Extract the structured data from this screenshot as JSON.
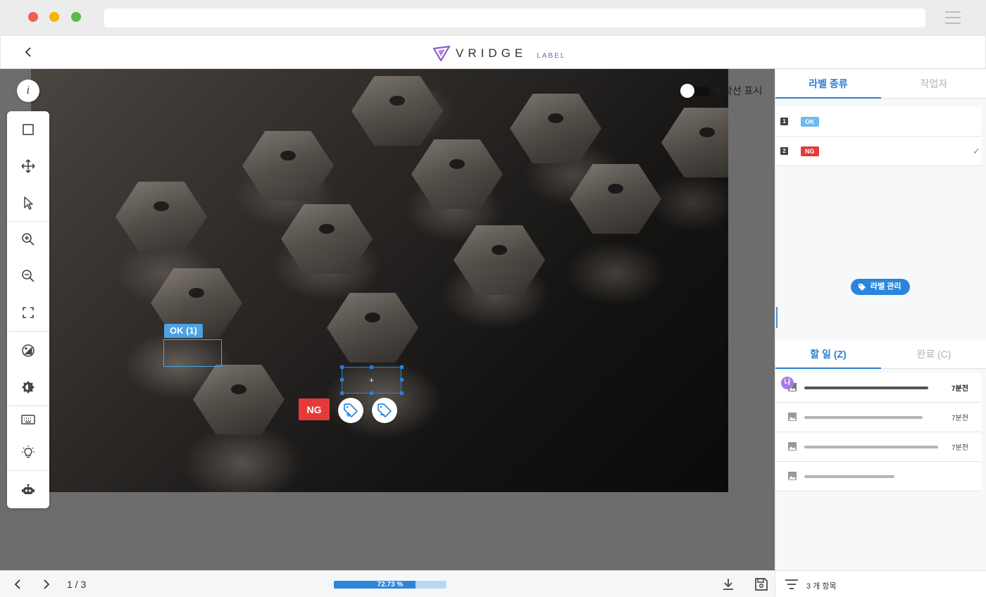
{
  "app": {
    "title": "VRIDGE",
    "subtitle": "LABEL",
    "brand_color": "#7f63b8"
  },
  "canvas": {
    "info_button": "i",
    "toggle_label": "외곽선 표시",
    "toggle_on": true,
    "annotations": {
      "ok_tag": "OK (1)",
      "ng_tag": "NG",
      "selected_box_crosshair": "+"
    }
  },
  "toolbar": {
    "tools": [
      "rectangle-icon",
      "move-icon",
      "pointer-icon",
      "zoom-in-icon",
      "zoom-out-icon",
      "fit-screen-icon",
      "contrast-icon",
      "brightness-icon",
      "keyboard-icon",
      "bulb-icon",
      "robot-icon"
    ]
  },
  "bottombar": {
    "pager": "1 / 3",
    "progress_text": "72.73 %",
    "progress_value": 0.7273,
    "colors": {
      "fill": "#2e86d9",
      "track": "#b9d7f2"
    }
  },
  "panel": {
    "top_tabs": [
      {
        "label": "라벨 종류",
        "active": true
      },
      {
        "label": "작업자",
        "active": false
      }
    ],
    "labels": [
      {
        "key": "1",
        "name": "OK",
        "color": "#6cb9ee",
        "checked": false
      },
      {
        "key": "2",
        "name": "NG",
        "color": "#e43a3a",
        "checked": true
      }
    ],
    "label_manage_button": "라벨 관리",
    "task_tabs": [
      {
        "label": "할 일  (Z)",
        "active": true
      },
      {
        "label": "완료  (C)",
        "active": false
      }
    ],
    "tasks": [
      {
        "avatar": "나",
        "time": "7분전",
        "bar_color": "#555555",
        "bold": true
      },
      {
        "avatar": "",
        "time": "7분전",
        "bar_color": "#b5b5b5",
        "bold": false
      },
      {
        "avatar": "",
        "time": "7분전",
        "bar_color": "#b5b5b5",
        "bold": false
      },
      {
        "avatar": "",
        "time": "",
        "bar_color": "#b5b5b5",
        "bold": false
      }
    ],
    "item_count": "3 개 항목"
  }
}
